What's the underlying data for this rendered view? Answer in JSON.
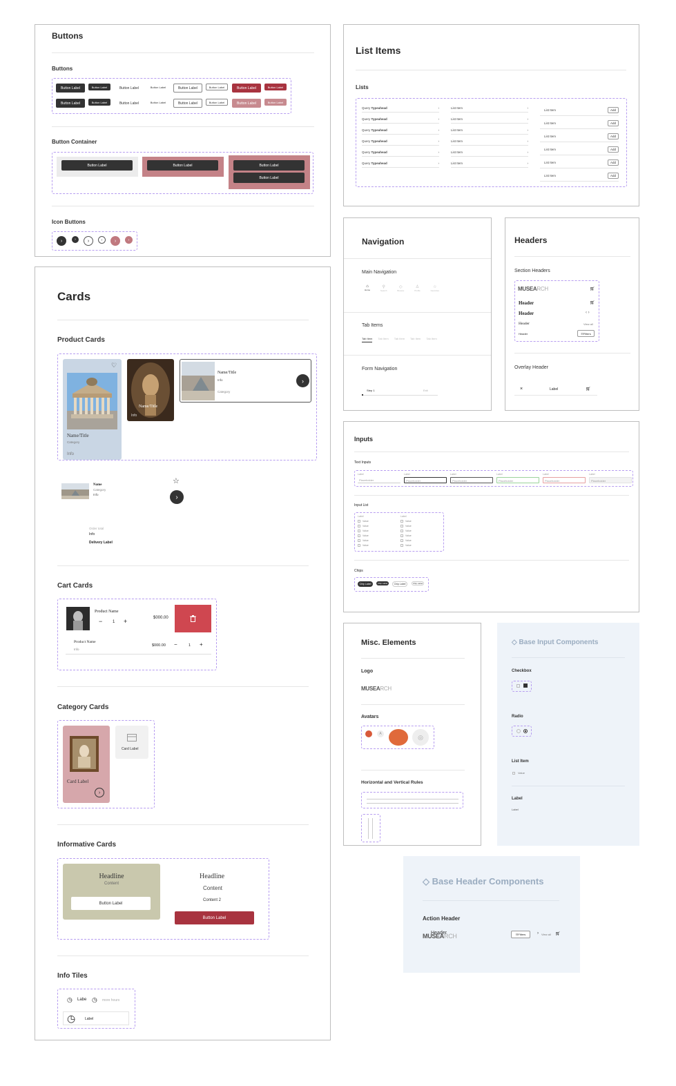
{
  "buttons": {
    "title": "Buttons",
    "sub_buttons": "Buttons",
    "button_label": "Button Label",
    "sub_container": "Button Container",
    "sub_icon": "Icon Buttons"
  },
  "cards": {
    "title": "Cards",
    "product_cards": "Product Cards",
    "name_title": "Name/Title",
    "category": "Category",
    "info": "Info",
    "name": "Name",
    "order_total": "Order total",
    "delivery_label": "Delivery Label",
    "cart_cards": "Cart Cards",
    "product_name": "Product Name",
    "price": "$000.00",
    "qty": "1",
    "category_cards": "Category Cards",
    "card_label": "Card Label",
    "informative_cards": "Informative Cards",
    "headline": "Headline",
    "content": "Content",
    "content2": "Content 2",
    "button_label": "Button Label",
    "info_tiles": "Info Tiles",
    "labe": "Labe",
    "more_hours": "more hours",
    "label": "Label"
  },
  "list_items": {
    "title": "List Items",
    "lists": "Lists",
    "query": "Query",
    "typeahead": "Typeahead",
    "list_item": "List Item",
    "add": "Add"
  },
  "navigation": {
    "title": "Navigation",
    "main_navigation": "Main Navigation",
    "nav_items": [
      "Home",
      "Search",
      "Browse",
      "Profile",
      "Favorites"
    ],
    "tab_items": "Tab Items",
    "tab_item": "Tab Item",
    "form_navigation": "Form Navigation",
    "step1": "Step 1",
    "exit": "Exit"
  },
  "headers": {
    "title": "Headers",
    "section_headers": "Section Headers",
    "header": "Header",
    "view_all": "View all",
    "filters": "Filters",
    "overlay_header": "Overlay Header",
    "label": "Label"
  },
  "logo": {
    "bold": "MUSEA",
    "light": "RCH"
  },
  "inputs": {
    "title": "Inputs",
    "text_inputs": "Text Inputs",
    "label": "Label",
    "placeholder": "Placeholder",
    "input_list": "Input List",
    "value": "Value",
    "chips": "Chips",
    "chip_label": "Chip Label"
  },
  "misc": {
    "title": "Misc. Elements",
    "logo": "Logo",
    "avatars": "Avatars",
    "rules": "Horizontal and Vertical Rules"
  },
  "base_input": {
    "title": "Base Input Components",
    "checkbox": "Checkbox",
    "radio": "Radio",
    "list_item": "List Item",
    "value": "Value",
    "label": "Label"
  },
  "base_header": {
    "title": "Base Header Components",
    "action_header": "Action Header",
    "header": "Header",
    "filters": "Filters",
    "view_all": "View all"
  },
  "colors": {
    "accent_red": "#a8333f",
    "accent_pink": "#c78a8f",
    "dark": "#333333",
    "dash": "#b69cf0",
    "panel_blue": "#eef3f9"
  }
}
